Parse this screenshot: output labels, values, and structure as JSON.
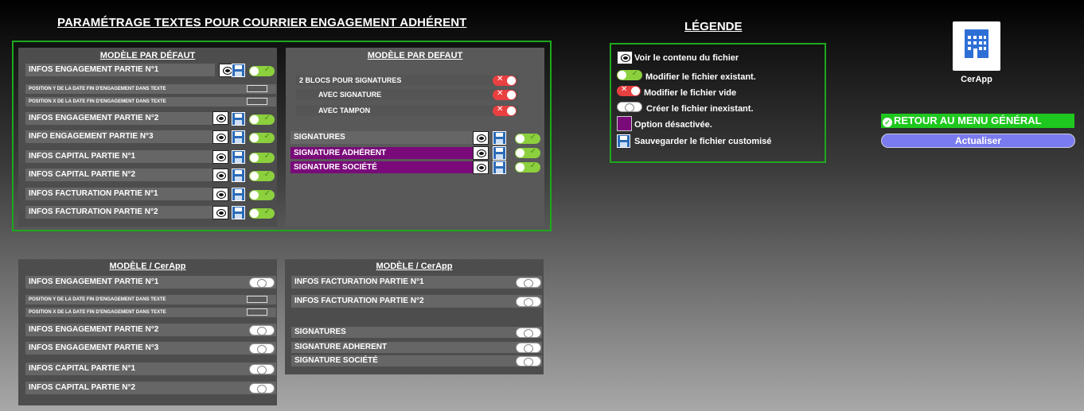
{
  "title": "PARAMÉTRAGE TEXTES POUR  COURRIER ENGAGEMENT ADHÉRENT",
  "legend": {
    "title": "LÉGENDE",
    "items": {
      "view": "Voir le contenu du fichier",
      "modify_existing": "Modifier le fichier existant.",
      "modify_empty": "Modifier le fichier vide",
      "create": "Créer le fichier inexistant.",
      "disabled": "Option désactivée.",
      "save": "Sauvegarder le fichier customisé"
    }
  },
  "app": {
    "label": "CerApp",
    "icon": "building-icon"
  },
  "buttons": {
    "back": "RETOUR AU MENU GÉNÉRAL",
    "refresh": "Actualiser"
  },
  "default_left": {
    "header": "MODÈLE PAR DÉFAUT",
    "rows": [
      "INFOS ENGAGEMENT PARTIE N°1",
      "POSITION Y DE LA DATE FIN D'ENGAGEMENT DANS TEXTE",
      "POSITION X DE LA DATE FIN D'ENGAGEMENT DANS TEXTE",
      "INFOS ENGAGEMENT PARTIE N°2",
      "INFO ENGAGEMENT PARTIE N°3",
      "INFOS CAPITAL PARTIE N°1",
      "INFOS CAPITAL PARTIE N°2",
      "INFOS FACTURATION PARTIE N°1",
      "INFOS FACTURATION PARTIE N°2"
    ]
  },
  "default_right": {
    "header": "MODÈLE PAR DEFAUT",
    "rows": [
      "2 BLOCS POUR SIGNATURES",
      "AVEC SIGNATURE",
      "AVEC TAMPON",
      "SIGNATURES",
      "SIGNATURE ADHÉRENT",
      "SIGNATURE SOCIÉTÉ"
    ]
  },
  "cerapp_left": {
    "header": "MODÈLE / CerApp",
    "rows": [
      "INFOS ENGAGEMENT PARTIE N°1",
      "POSITION Y DE LA DATE FIN D'ENGAGEMENT DANS TEXTE",
      "POSITION X DE LA DATE FIN D'ENGAGEMENT DANS TEXTE",
      "INFOS ENGAGEMENT  PARTIE N°2",
      "INFOS ENGAGEMENT PARTIE N°3",
      "INFOS CAPITAL PARTIE N°1",
      "INFOS CAPITAL PARTIE N°2"
    ]
  },
  "cerapp_right": {
    "header": "MODÈLE / CerApp",
    "rows": [
      "INFOS FACTURATION PARTIE N°1",
      "INFOS FACTURATION PARTIE N°2",
      "SIGNATURES",
      "SIGNATURE ADHERENT",
      "SIGNATURE SOCIÉTÉ"
    ]
  },
  "colors": {
    "frame_green": "#1ea81e",
    "toggle_on": "#8cd03e",
    "toggle_empty": "#e84040",
    "disabled_purple": "#7a0a7a",
    "save_blue": "#2c6bb8",
    "back_button": "#1ec81e",
    "refresh_button": "#7b7bf0"
  }
}
